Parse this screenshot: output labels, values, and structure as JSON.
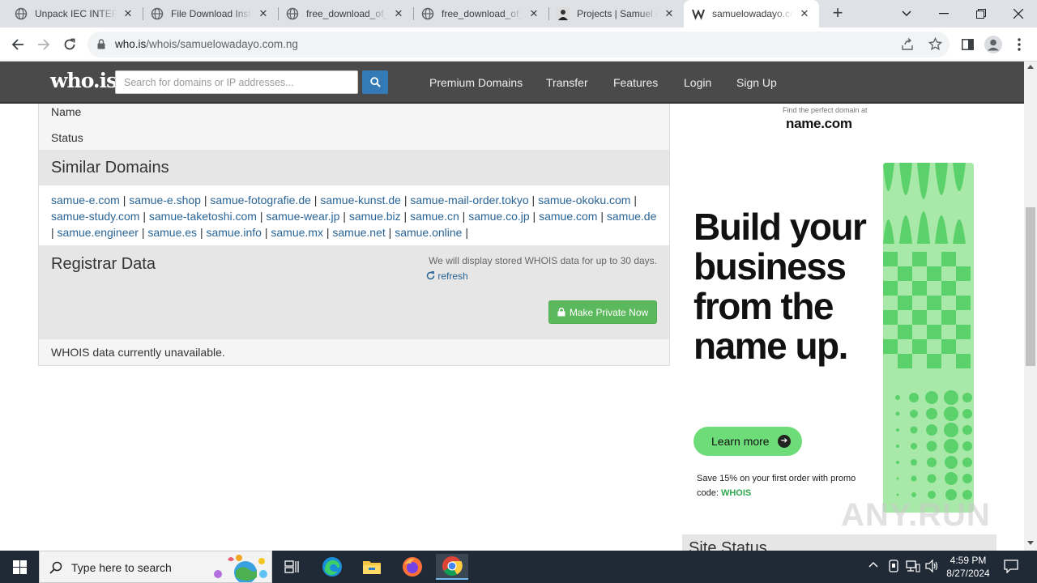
{
  "tabs": [
    {
      "title": "Unpack IEC INTERNATIONAL",
      "favicon": "globe-icon"
    },
    {
      "title": "File Download Instructions",
      "favicon": "globe-icon"
    },
    {
      "title": "free_download_of_",
      "favicon": "globe-icon"
    },
    {
      "title": "free_download_of_",
      "favicon": "globe-icon"
    },
    {
      "title": "Projects | Samuel Owadayo",
      "favicon": "person-icon"
    },
    {
      "title": "samuelowadayo.com.ng",
      "favicon": "whois-icon"
    }
  ],
  "toolbar": {
    "url_host": "who.is",
    "url_path": "/whois/samuelowadayo.com.ng"
  },
  "site": {
    "logo": "who.is",
    "search_placeholder": "Search for domains or IP addresses...",
    "nav": [
      "Premium Domains",
      "Transfer",
      "Features",
      "Login",
      "Sign Up"
    ]
  },
  "whois": {
    "name_label": "Name",
    "status_label": "Status",
    "similar_heading": "Similar Domains",
    "similar_domains": [
      "samue-e.com",
      "samue-e.shop",
      "samue-fotografie.de",
      "samue-kunst.de",
      "samue-mail-order.tokyo",
      "samue-okoku.com",
      "samue-study.com",
      "samue-taketoshi.com",
      "samue-wear.jp",
      "samue.biz",
      "samue.cn",
      "samue.co.jp",
      "samue.com",
      "samue.de",
      "samue.engineer",
      "samue.es",
      "samue.info",
      "samue.mx",
      "samue.net",
      "samue.online"
    ],
    "registrar_heading": "Registrar Data",
    "registrar_note": "We will display stored WHOIS data for up to 30 days.",
    "refresh_label": "refresh",
    "private_button": "Make Private Now",
    "unavailable": "WHOIS data currently unavailable."
  },
  "ad": {
    "tagline": "Find the perfect domain at",
    "brand": "name.com",
    "headline": "Build your business from the name up.",
    "cta": "Learn more",
    "promo_text": "Save 15% on your first order with promo code:",
    "promo_code": "WHOIS"
  },
  "site_status_heading": "Site Status",
  "watermark": "ANY.RUN",
  "taskbar": {
    "search_placeholder": "Type here to search",
    "time": "4:59 PM",
    "date": "8/27/2024"
  },
  "colors": {
    "nav_bg": "#4a4a4a",
    "link": "#2a6496",
    "button_green": "#5cb85c",
    "ad_green": "#6fdc7a"
  }
}
